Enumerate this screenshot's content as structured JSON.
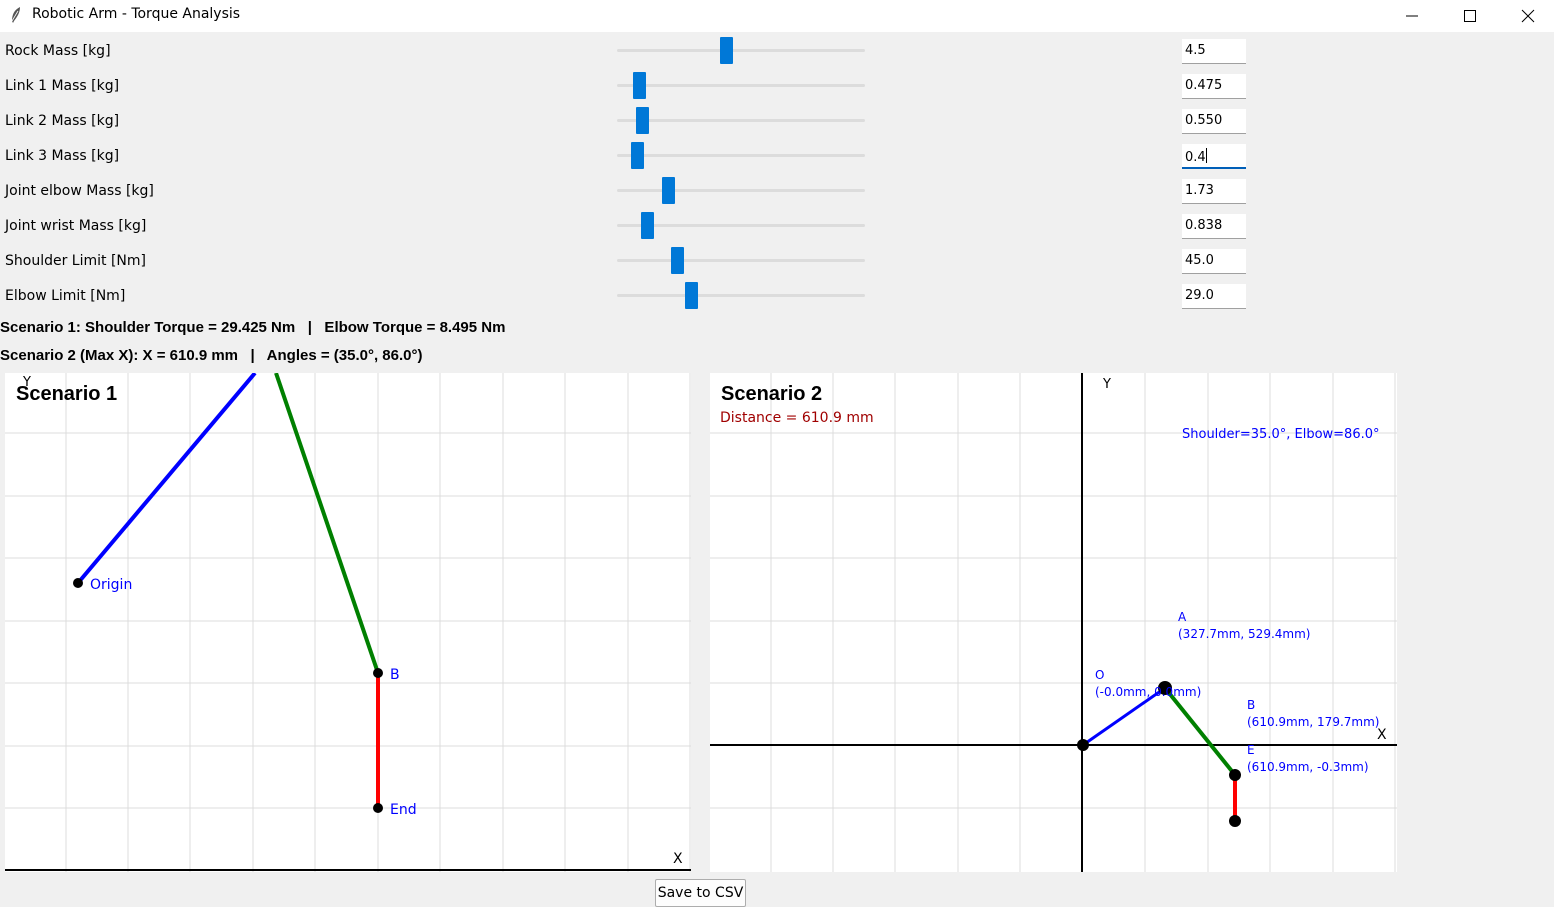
{
  "window": {
    "title": "Robotic Arm - Torque Analysis"
  },
  "parameters": [
    {
      "label": "Rock Mass [kg]",
      "value": "4.5",
      "level": 0.44
    },
    {
      "label": "Link 1 Mass [kg]",
      "value": "0.475",
      "level": 0.07
    },
    {
      "label": "Link 2 Mass [kg]",
      "value": "0.550",
      "level": 0.08
    },
    {
      "label": "Link 3 Mass [kg]",
      "value": "0.4",
      "level": 0.06
    },
    {
      "label": "Joint elbow Mass [kg]",
      "value": "1.73",
      "level": 0.19
    },
    {
      "label": "Joint wrist Mass [kg]",
      "value": "0.838",
      "level": 0.1
    },
    {
      "label": "Shoulder Limit [Nm]",
      "value": "45.0",
      "level": 0.23
    },
    {
      "label": "Elbow Limit [Nm]",
      "value": "29.0",
      "level": 0.29
    }
  ],
  "summary": {
    "scenario1": "Scenario 1: Shoulder Torque = 29.425 Nm   |   Elbow Torque = 8.495 Nm",
    "scenario2": "Scenario 2 (Max X): X = 610.9 mm   |   Angles = (35.0°, 86.0°)"
  },
  "scenario1": {
    "title": "Scenario 1",
    "axis_x": "X",
    "axis_y": "Y",
    "origin_label": "Origin",
    "b_label": "B",
    "end_label": "End"
  },
  "scenario2": {
    "title": "Scenario 2",
    "distance": "Distance = 610.9 mm",
    "angles": "Shoulder=35.0°, Elbow=86.0°",
    "axis_x": "X",
    "axis_y": "Y",
    "o_label": "O",
    "o_coord": "(-0.0mm, 0.0mm)",
    "a_label": "A",
    "a_coord": "(327.7mm, 529.4mm)",
    "b_label": "B",
    "b_coord": "(610.9mm, 179.7mm)",
    "e_label": "E",
    "e_coord": "(610.9mm, -0.3mm)"
  },
  "buttons": {
    "save": "Save to CSV"
  },
  "colors": {
    "link1": "#0000ff",
    "link2": "#008000",
    "link3": "#ff0000",
    "label_blue": "#0000ff",
    "distance_red": "#a00000",
    "slider_accent": "#0078d7"
  }
}
